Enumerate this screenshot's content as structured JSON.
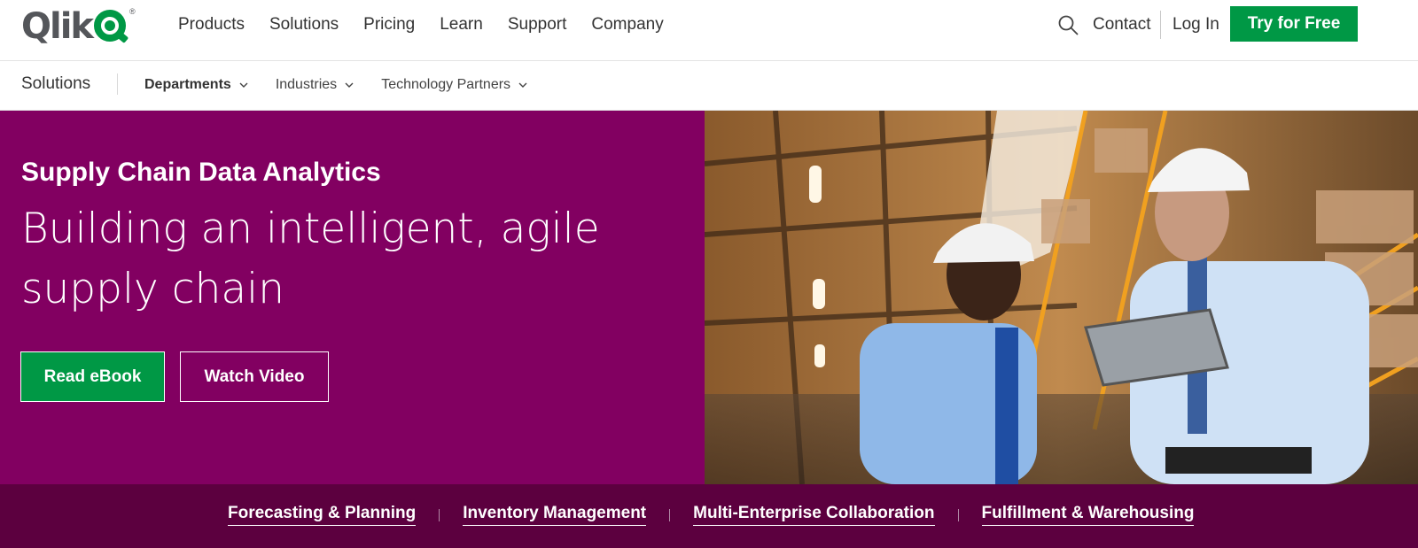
{
  "header": {
    "logo_text": "Qlik",
    "logo_registered": "®",
    "nav": [
      "Products",
      "Solutions",
      "Pricing",
      "Learn",
      "Support",
      "Company"
    ],
    "contact_label": "Contact",
    "login_label": "Log In",
    "cta_label": "Try for Free"
  },
  "subnav": {
    "title": "Solutions",
    "items": [
      {
        "label": "Departments",
        "active": true
      },
      {
        "label": "Industries",
        "active": false
      },
      {
        "label": "Technology Partners",
        "active": false
      }
    ]
  },
  "hero": {
    "eyebrow": "Supply Chain Data Analytics",
    "title": "Building an intelligent, agile supply chain",
    "primary_button": "Read eBook",
    "secondary_button": "Watch Video"
  },
  "strip": {
    "links": [
      "Forecasting & Planning",
      "Inventory Management",
      "Multi-Enterprise Collaboration",
      "Fulfillment & Warehousing"
    ]
  },
  "colors": {
    "brand_green": "#009845",
    "hero_purple": "#820061",
    "strip_purple": "#5c003f"
  },
  "icons": {
    "search": "search-icon",
    "chevron": "chevron-down-icon"
  }
}
